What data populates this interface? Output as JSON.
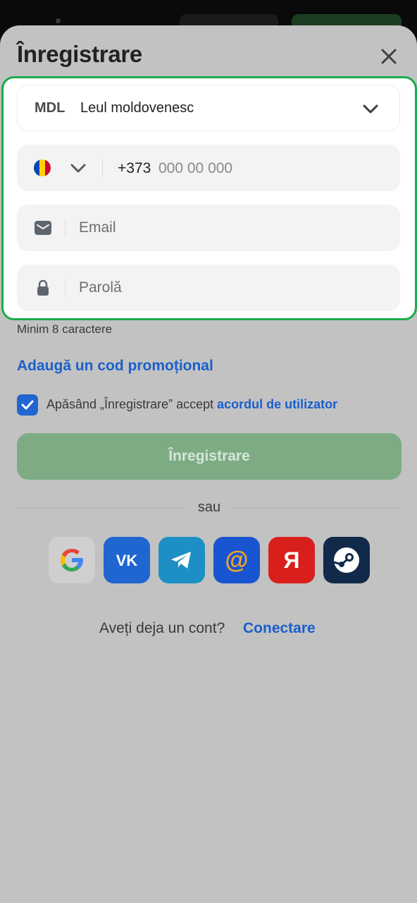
{
  "title": "Înregistrare",
  "currency": {
    "code": "MDL",
    "name": "Leul moldovenesc"
  },
  "phone": {
    "code": "+373",
    "placeholder": "000 00 000",
    "flag_colors": [
      "#0046ae",
      "#ffd200",
      "#cc092f"
    ]
  },
  "email": {
    "placeholder": "Email"
  },
  "password": {
    "placeholder": "Parolă",
    "hint": "Minim 8 caractere"
  },
  "promo_link": "Adaugă un cod promoțional",
  "agreement": {
    "text": "Apăsând „Înregistrare” accept",
    "link": "acordul de utilizator",
    "checked": true
  },
  "register_button": "Înregistrare",
  "divider_text": "sau",
  "social": [
    {
      "name": "google",
      "icon": "google-icon",
      "color": "#cfcfcf",
      "glyph": "G"
    },
    {
      "name": "vk",
      "icon": "vk-icon",
      "color": "#1f66d1",
      "glyph": "VK"
    },
    {
      "name": "telegram",
      "icon": "telegram-icon",
      "color": "#1d8fc4",
      "glyph": ""
    },
    {
      "name": "mailru",
      "icon": "mailru-icon",
      "color": "#1a55d1",
      "glyph": "@"
    },
    {
      "name": "yandex",
      "icon": "yandex-icon",
      "color": "#d81f1c",
      "glyph": "Я"
    },
    {
      "name": "steam",
      "icon": "steam-icon",
      "color": "#112a4a",
      "glyph": ""
    }
  ],
  "footer": {
    "question": "Aveți deja un cont?",
    "link": "Conectare"
  },
  "colors": {
    "accent": "#1a5fcc",
    "highlight_border": "#1aab4a",
    "button": "#7dac84"
  }
}
